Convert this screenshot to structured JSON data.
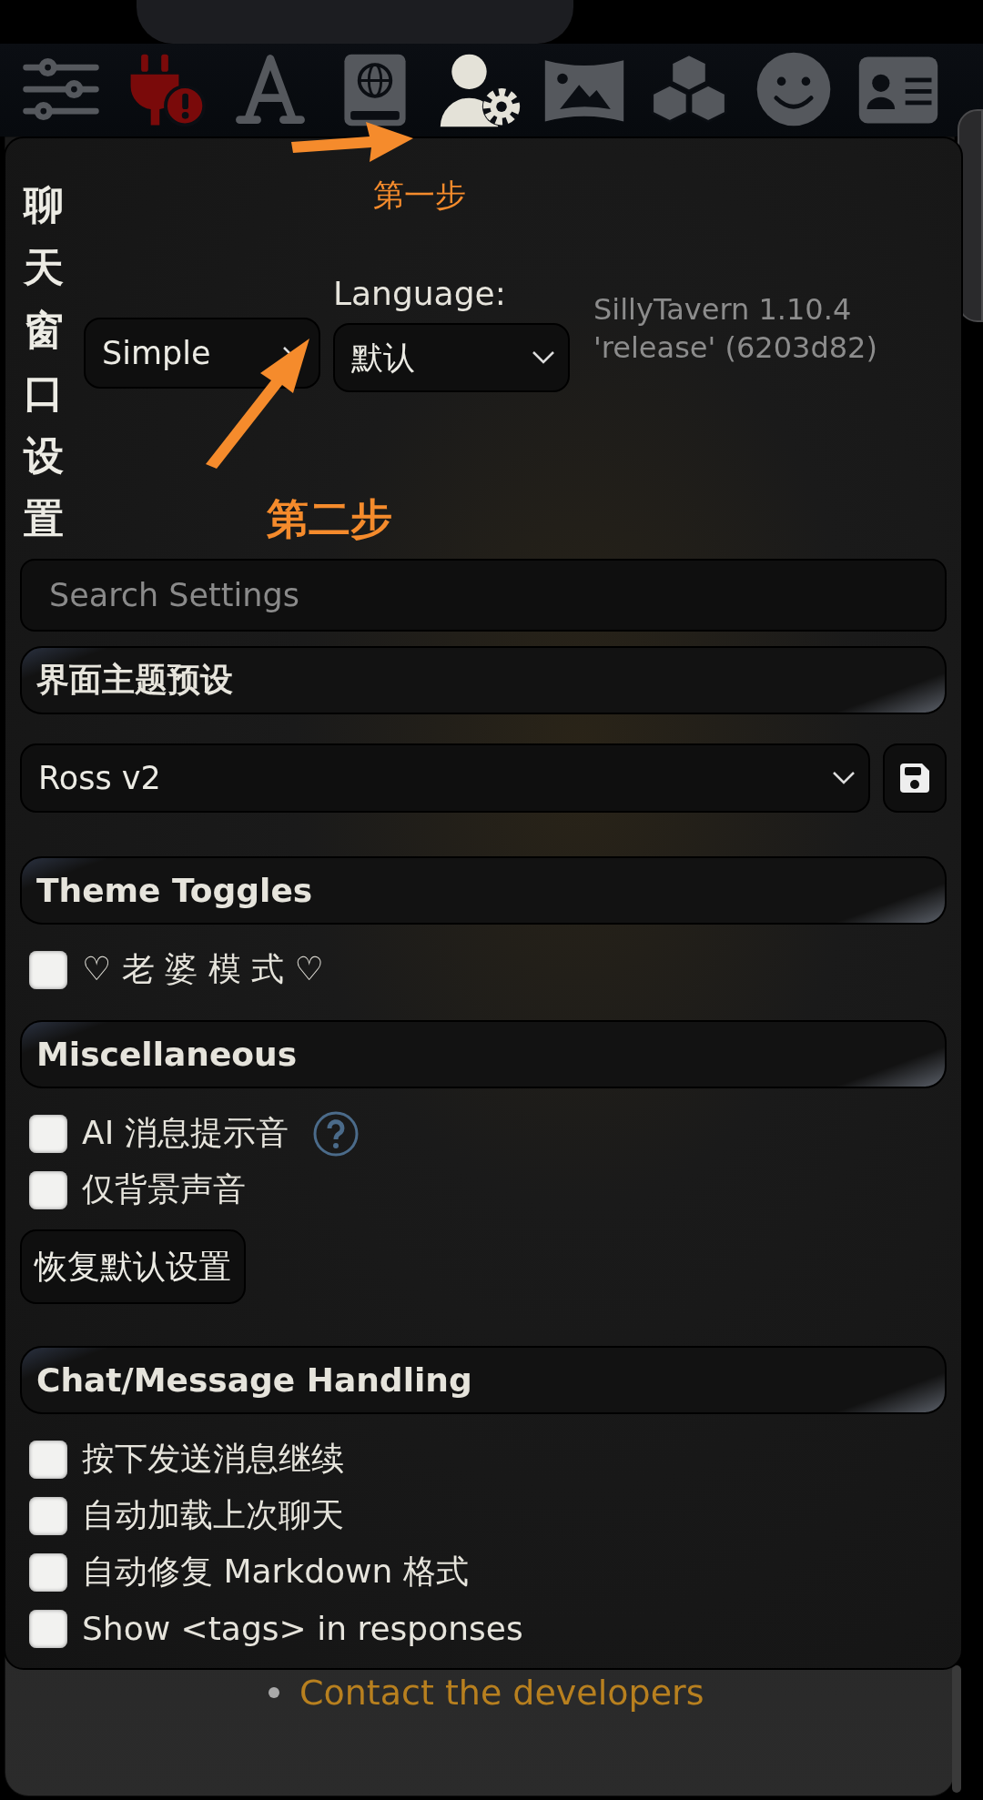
{
  "toolbar": {
    "icons": [
      {
        "selected": false
      },
      {
        "selected": false
      },
      {
        "selected": false
      },
      {
        "selected": false
      },
      {
        "selected": true
      },
      {
        "selected": false
      },
      {
        "selected": false
      },
      {
        "selected": false
      },
      {
        "selected": false
      }
    ]
  },
  "annotations": [
    {
      "text": "第一步"
    },
    {
      "text": "第二步"
    }
  ],
  "panel": {
    "title": "聊天窗口设置",
    "mode_select": {
      "value": "Simple"
    },
    "language": {
      "label": "Language:",
      "value": "默认"
    },
    "version": [
      "SillyTavern 1.10.4",
      "'release' (6203d82)"
    ]
  },
  "search": {
    "placeholder": "Search Settings"
  },
  "sections": [
    {
      "title": "界面主题预设",
      "preset": {
        "value": "Ross v2"
      }
    },
    {
      "title": "Theme Toggles",
      "options": [
        {
          "label": "♡ 老 婆 模 式 ♡",
          "checked": false
        }
      ]
    },
    {
      "title": "Miscellaneous",
      "options": [
        {
          "label": "AI 消息提示音",
          "checked": false,
          "help": true
        },
        {
          "label": "仅背景声音",
          "checked": false
        }
      ],
      "button": "恢复默认设置"
    },
    {
      "title": "Chat/Message Handling",
      "options": [
        {
          "label": "按下发送消息继续",
          "checked": false
        },
        {
          "label": "自动加载上次聊天",
          "checked": false
        },
        {
          "label": "自动修复 Markdown 格式",
          "checked": false
        },
        {
          "label": "Show <tags> in responses",
          "checked": false
        }
      ]
    }
  ],
  "background": {
    "links": [
      "Contact the developers"
    ]
  }
}
